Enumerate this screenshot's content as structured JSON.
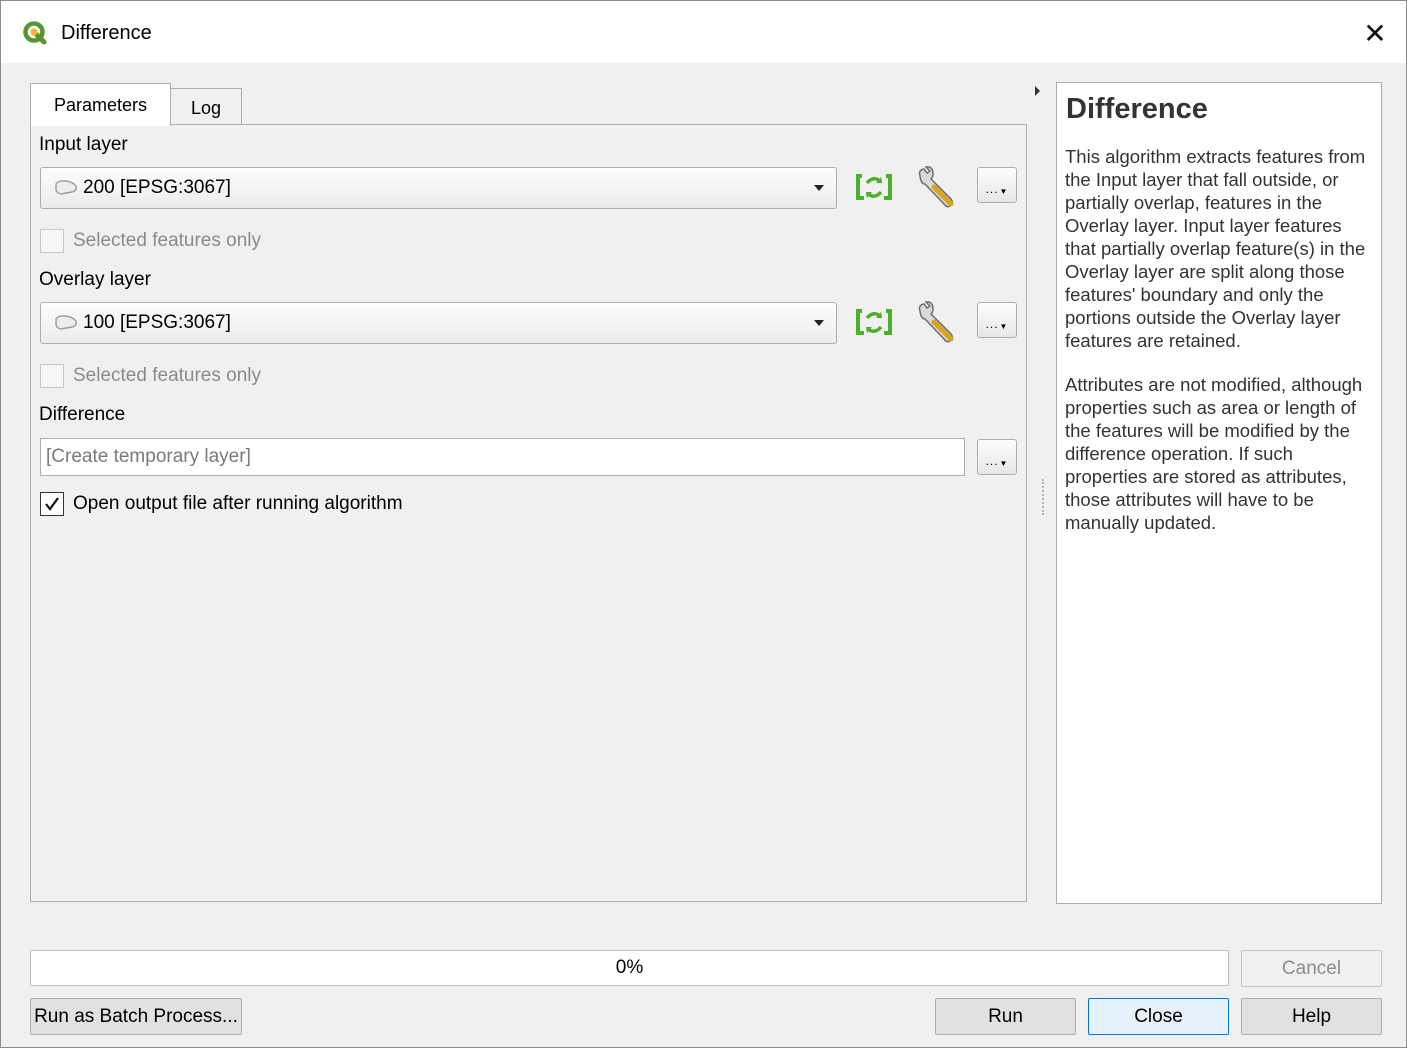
{
  "window": {
    "title": "Difference",
    "close_glyph": "✕"
  },
  "tabs": [
    {
      "label": "Parameters",
      "active": true
    },
    {
      "label": "Log",
      "active": false
    }
  ],
  "params": {
    "input_layer": {
      "label": "Input layer",
      "value": "200 [EPSG:3067]",
      "selected_only_label": "Selected features only",
      "selected_only_checked": false
    },
    "overlay_layer": {
      "label": "Overlay layer",
      "value": "100 [EPSG:3067]",
      "selected_only_label": "Selected features only",
      "selected_only_checked": false
    },
    "output": {
      "label": "Difference",
      "placeholder": "[Create temporary layer]",
      "open_after_label": "Open output file after running algorithm",
      "open_after_checked": true
    },
    "dots_label": "...",
    "icons": [
      "polygon-layer-icon",
      "iterate-icon",
      "wrench-icon",
      "dropdown-arrow-icon"
    ]
  },
  "help": {
    "title": "Difference",
    "paragraphs": [
      "This algorithm extracts features from the Input layer that fall outside, or partially overlap, features in the Overlay layer. Input layer features that partially overlap feature(s) in the Overlay layer are split along those features' boundary and only the portions outside the Overlay layer features are retained.",
      "Attributes are not modified, although properties such as area or length of the features will be modified by the difference operation. If such properties are stored as attributes, those attributes will have to be manually updated."
    ]
  },
  "progress": {
    "value": 0,
    "label": "0%"
  },
  "buttons": {
    "cancel": "Cancel",
    "batch": "Run as Batch Process...",
    "run": "Run",
    "close": "Close",
    "help": "Help"
  },
  "colors": {
    "accent": "#0078d7",
    "iterate_green": "#4caf2c",
    "qgis_green": "#589632"
  }
}
